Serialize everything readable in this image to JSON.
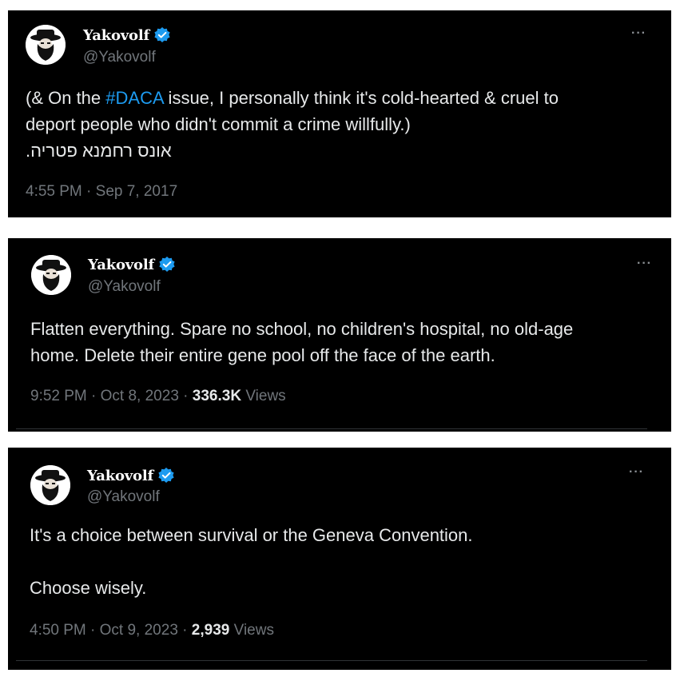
{
  "tweets": [
    {
      "display_name": "Yakovolf",
      "handle": "@Yakovolf",
      "text_before_hashtag": "(& On the ",
      "hashtag": "#DACA",
      "text_after_hashtag": " issue, I personally think it's cold-hearted & cruel to\ndeport people who didn't commit a crime willfully.)",
      "hebrew_line": ".אונס רחמנא פטריה",
      "time": "4:55 PM",
      "date": "Sep 7, 2017",
      "more": "···"
    },
    {
      "display_name": "Yakovolf",
      "handle": "@Yakovolf",
      "text": "Flatten everything. Spare no school, no children's hospital, no old-age\nhome. Delete their entire gene pool off the face of the earth.",
      "time": "9:52 PM",
      "date": "Oct 8, 2023",
      "views_count": "336.3K",
      "views_label": "Views",
      "more": "···"
    },
    {
      "display_name": "Yakovolf",
      "handle": "@Yakovolf",
      "text": "It's a choice between survival or the Geneva Convention.\n\nChoose wisely.",
      "time": "4:50 PM",
      "date": "Oct 9, 2023",
      "views_count": "2,939",
      "views_label": "Views",
      "more": "···"
    }
  ],
  "separator": " · ",
  "colors": {
    "background": "#000000",
    "text": "#e7e9ea",
    "secondary_text": "#71767b",
    "link": "#1d9bf0",
    "verified_badge": "#1d9bf0"
  },
  "icons": {
    "verified": "verified-badge-icon",
    "avatar": "hat-beard-avatar",
    "more": "more-options-icon"
  }
}
